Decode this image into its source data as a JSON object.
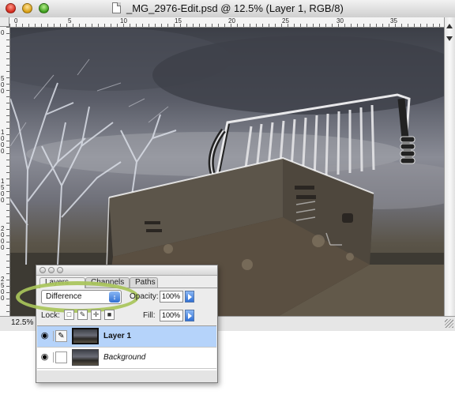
{
  "window": {
    "title": "_MG_2976-Edit.psd @ 12.5% (Layer 1, RGB/8)",
    "zoom": "12.5%"
  },
  "rulers": {
    "top_ticks": [
      "0",
      "5",
      "10",
      "15",
      "20",
      "25",
      "30",
      "35"
    ],
    "left_ticks": [
      "0",
      "500",
      "1000",
      "1500",
      "2000",
      "2500"
    ]
  },
  "layers_palette": {
    "tabs": [
      "Layers",
      "Channels",
      "Paths"
    ],
    "blend_mode": "Difference",
    "opacity_label": "Opacity:",
    "opacity_value": "100%",
    "lock_label": "Lock:",
    "fill_label": "Fill:",
    "fill_value": "100%",
    "layers": [
      {
        "name": "Layer 1",
        "selected": true
      },
      {
        "name": "Background",
        "selected": false
      }
    ]
  },
  "colors": {
    "highlight_ellipse": "#a8c45a",
    "selection": "#b5d3fa"
  }
}
